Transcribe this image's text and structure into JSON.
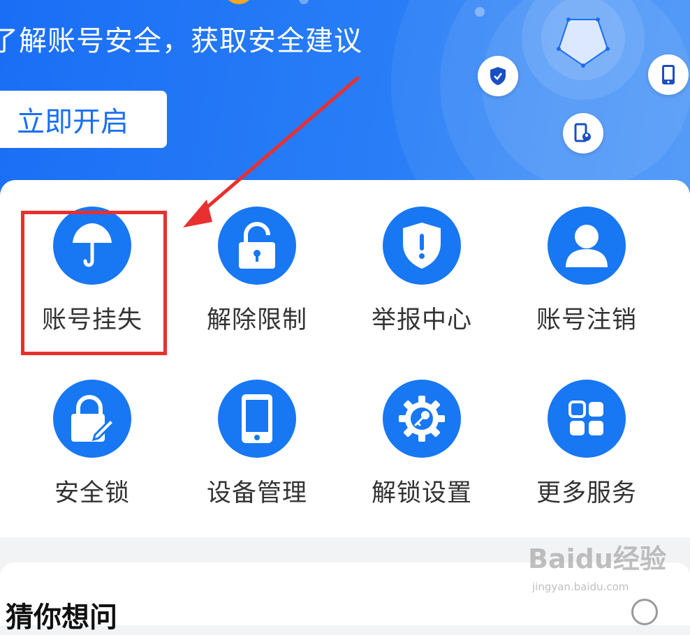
{
  "banner": {
    "subtitle": "了解账号安全，获取安全建议",
    "cta_label": "立即开启"
  },
  "services": {
    "items": [
      {
        "label": "账号挂失",
        "icon": "umbrella-icon"
      },
      {
        "label": "解除限制",
        "icon": "unlock-icon"
      },
      {
        "label": "举报中心",
        "icon": "shield-alert-icon"
      },
      {
        "label": "账号注销",
        "icon": "user-icon"
      },
      {
        "label": "安全锁",
        "icon": "lock-edit-icon"
      },
      {
        "label": "设备管理",
        "icon": "phone-icon"
      },
      {
        "label": "解锁设置",
        "icon": "gear-key-icon"
      },
      {
        "label": "更多服务",
        "icon": "grid-apps-icon"
      }
    ]
  },
  "recommend": {
    "title": "猜你想问"
  },
  "watermark": {
    "brand": "Baidu经验",
    "url": "jingyan.baidu.com"
  },
  "colors": {
    "primary": "#1877f2",
    "banner": "#1a6ef5",
    "highlight": "#e8302f"
  }
}
